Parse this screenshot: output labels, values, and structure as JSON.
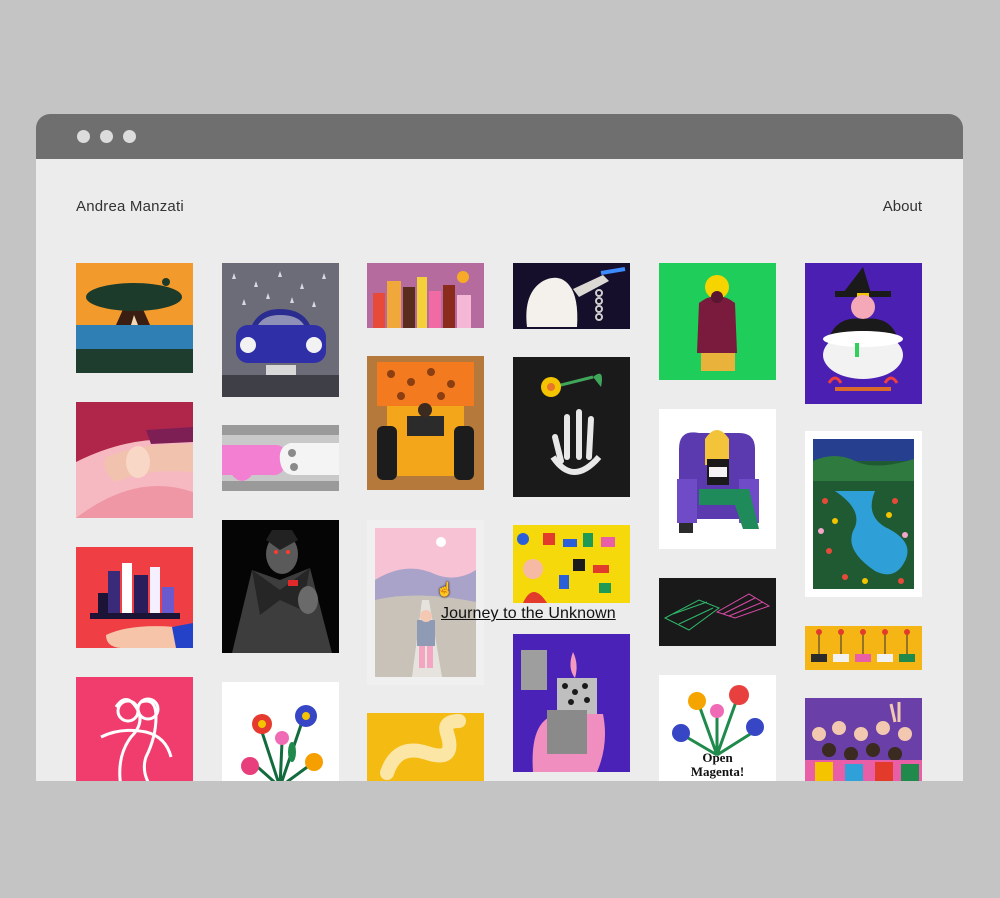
{
  "window": {
    "controls": [
      "close",
      "minimize",
      "maximize"
    ]
  },
  "header": {
    "brand": "Andrea Manzati",
    "about_label": "About"
  },
  "gallery": {
    "hover_caption": "Journey to the Unknown",
    "items": [
      {
        "name": "tree-sunset"
      },
      {
        "name": "blue-car-rain"
      },
      {
        "name": "potion-bottles"
      },
      {
        "name": "ghost-chain"
      },
      {
        "name": "green-saint"
      },
      {
        "name": "witch-cauldron"
      },
      {
        "name": "mouth-finger"
      },
      {
        "name": "fist-bump"
      },
      {
        "name": "tractor"
      },
      {
        "name": "skeleton-hand-flower"
      },
      {
        "name": "woman-chair-reading"
      },
      {
        "name": "landscape-map"
      },
      {
        "name": "city-on-hand"
      },
      {
        "name": "vampire"
      },
      {
        "name": "journey-to-the-unknown"
      },
      {
        "name": "puzzle-girl"
      },
      {
        "name": "wireframe-hands"
      },
      {
        "name": "food-skewers"
      },
      {
        "name": "embracing-couple"
      },
      {
        "name": "flowers-bouquet"
      },
      {
        "name": "yellow-snake"
      },
      {
        "name": "lighter"
      },
      {
        "name": "open-magenta"
      },
      {
        "name": "crowd"
      }
    ],
    "open_magenta_text": [
      "Open",
      "Magenta!"
    ]
  },
  "colors": {
    "page_bg": "#c4c4c4",
    "window_bg": "#ececec",
    "titlebar": "#6f6f6f"
  }
}
